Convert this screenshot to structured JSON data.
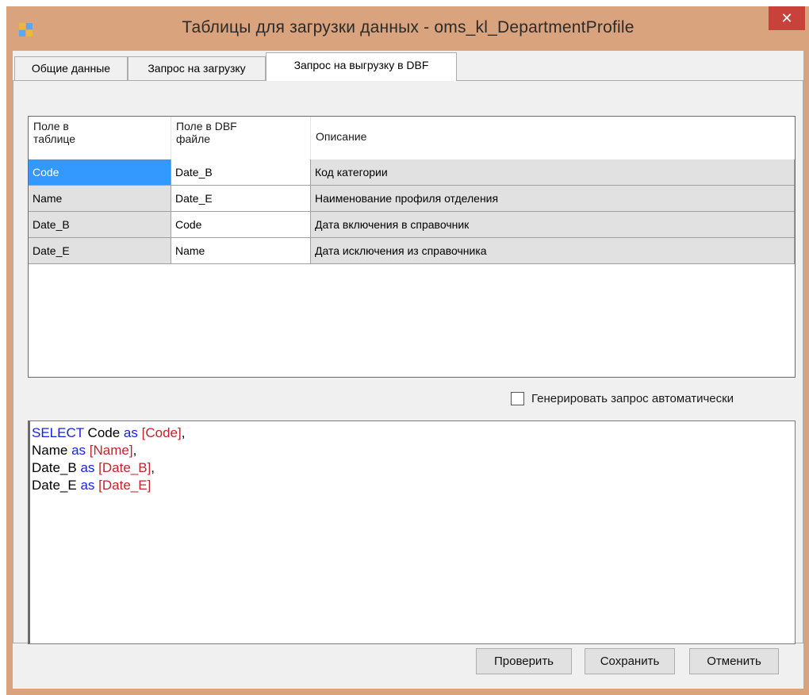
{
  "window": {
    "title": "Таблицы для загрузки данных - oms_kl_DepartmentProfile",
    "close_glyph": "✕"
  },
  "tabs": [
    {
      "label": "Общие данные",
      "active": false
    },
    {
      "label": "Запрос на загрузку",
      "active": false
    },
    {
      "label": "Запрос на выгрузку в DBF",
      "active": true
    }
  ],
  "grid": {
    "headers": [
      "Поле в\nтаблице",
      "Поле в DBF\nфайле",
      "Описание"
    ],
    "rows": [
      {
        "field": "Code",
        "dbf": "Date_B",
        "description": "Код категории",
        "selected": true
      },
      {
        "field": "Name",
        "dbf": "Date_E",
        "description": "Наименование профиля отделения",
        "selected": false
      },
      {
        "field": "Date_B",
        "dbf": "Code",
        "description": "Дата включения в справочник",
        "selected": false
      },
      {
        "field": "Date_E",
        "dbf": "Name",
        "description": "Дата исключения из справочника",
        "selected": false
      }
    ]
  },
  "auto_generate": {
    "label": "Генерировать запрос автоматически",
    "checked": false
  },
  "sql": {
    "lines": [
      [
        {
          "t": "SELECT",
          "c": "kw"
        },
        {
          "t": " Code ",
          "c": ""
        },
        {
          "t": "as",
          "c": "kw"
        },
        {
          "t": " ",
          "c": ""
        },
        {
          "t": "[Code]",
          "c": "br"
        },
        {
          "t": ",",
          "c": ""
        }
      ],
      [
        {
          "t": "Name ",
          "c": ""
        },
        {
          "t": "as",
          "c": "kw"
        },
        {
          "t": " ",
          "c": ""
        },
        {
          "t": "[Name]",
          "c": "br"
        },
        {
          "t": ",",
          "c": ""
        }
      ],
      [
        {
          "t": "Date_B ",
          "c": ""
        },
        {
          "t": "as",
          "c": "kw"
        },
        {
          "t": " ",
          "c": ""
        },
        {
          "t": "[Date_B]",
          "c": "br"
        },
        {
          "t": ",",
          "c": ""
        }
      ],
      [
        {
          "t": "Date_E ",
          "c": ""
        },
        {
          "t": "as",
          "c": "kw"
        },
        {
          "t": " ",
          "c": ""
        },
        {
          "t": "[Date_E]",
          "c": "br"
        }
      ]
    ]
  },
  "buttons": {
    "check": "Проверить",
    "save": "Сохранить",
    "cancel": "Отменить"
  },
  "colors": {
    "frame": "#d9a37e",
    "close": "#c9413b",
    "selection": "#3399ff",
    "keyword": "#1a22e0",
    "bracket": "#c0242a"
  }
}
